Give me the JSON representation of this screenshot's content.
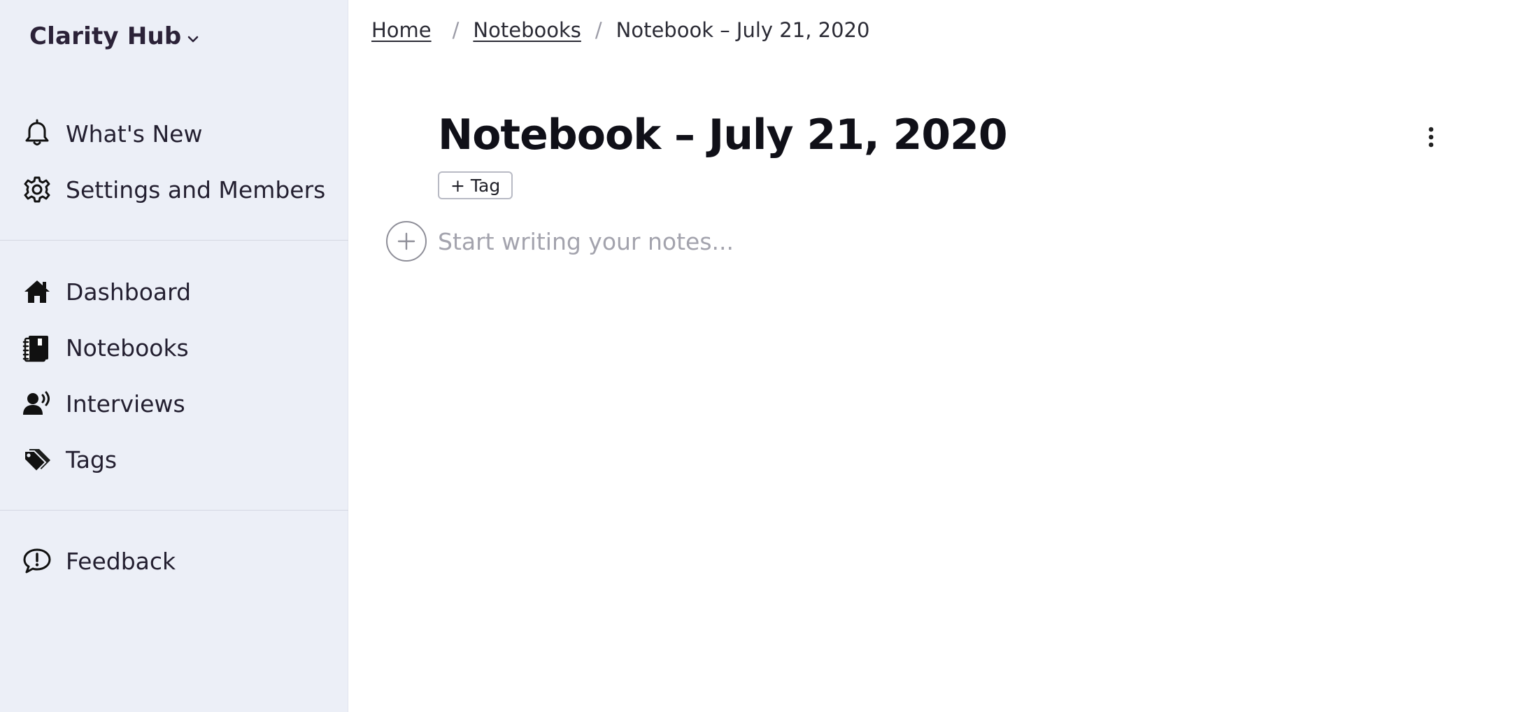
{
  "sidebar": {
    "brand": "Clarity Hub",
    "top_items": [
      {
        "label": "What's New",
        "icon": "bell-icon"
      },
      {
        "label": "Settings and Members",
        "icon": "gear-icon"
      }
    ],
    "main_items": [
      {
        "label": "Dashboard",
        "icon": "home-icon"
      },
      {
        "label": "Notebooks",
        "icon": "notebooks-icon"
      },
      {
        "label": "Interviews",
        "icon": "interviews-icon"
      },
      {
        "label": "Tags",
        "icon": "tags-icon"
      }
    ],
    "bottom_items": [
      {
        "label": "Feedback",
        "icon": "feedback-icon"
      }
    ]
  },
  "breadcrumb": {
    "items": [
      {
        "label": "Home",
        "link": true
      },
      {
        "label": "Notebooks",
        "link": true
      },
      {
        "label": "Notebook – July 21, 2020",
        "link": false
      }
    ],
    "separator": "/"
  },
  "main": {
    "title": "Notebook – July 21, 2020",
    "tag_button_label": "+ Tag",
    "notes_placeholder": "Start writing your notes...",
    "notes_value": ""
  },
  "colors": {
    "sidebar_bg": "#eceff7",
    "brand_text": "#2b2238",
    "placeholder": "#a3a3ad"
  }
}
